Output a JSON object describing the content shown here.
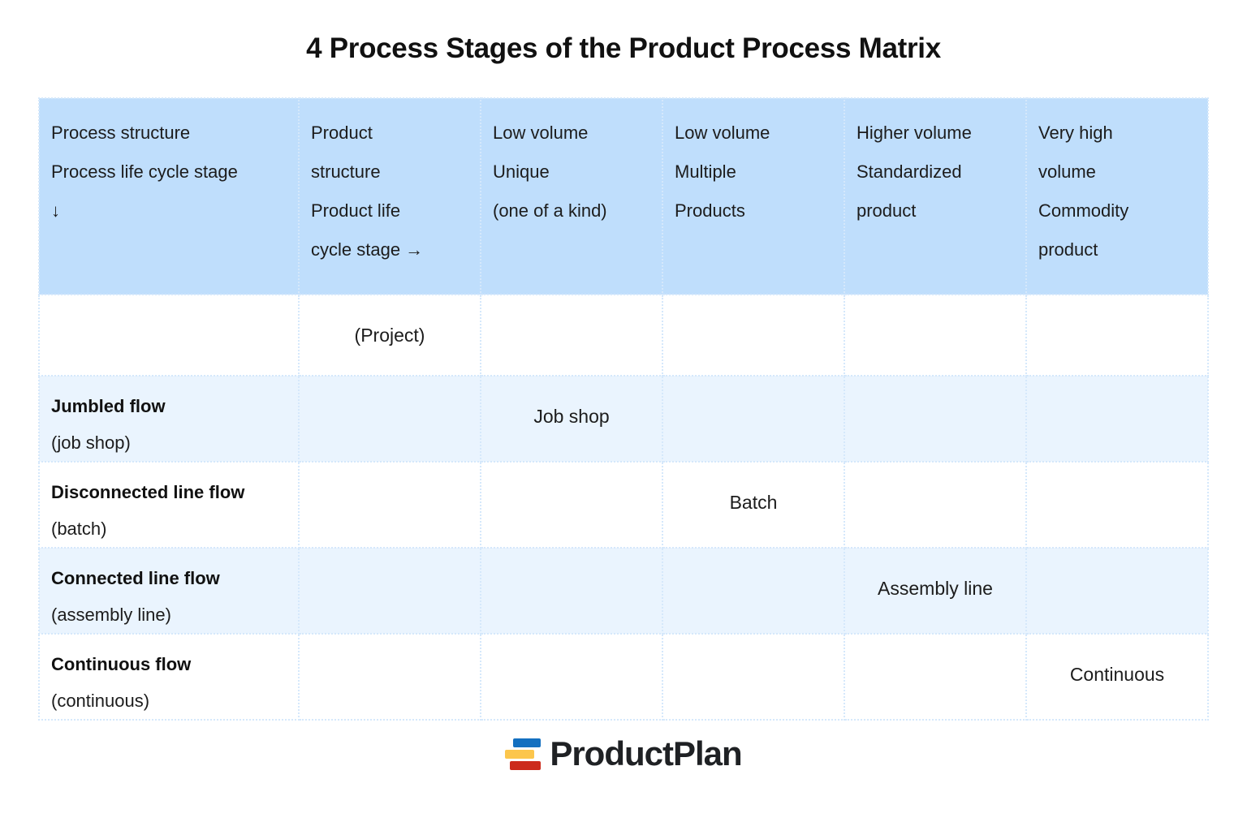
{
  "title": "4 Process Stages of the Product Process Matrix",
  "colors": {
    "header_bg": "#bfdefc",
    "row_tint_bg": "#eaf4fe",
    "row_white_bg": "#ffffff",
    "border": "#d5e8fb",
    "text": "#1c1c1c",
    "logo_blue": "#1470c0",
    "logo_yellow": "#fcc64c",
    "logo_red": "#cc2b1c",
    "logo_word": "#1f2124"
  },
  "matrix": {
    "header": [
      {
        "name": "process-structure",
        "lines": [
          "Process structure",
          "Process life cycle stage",
          "↓"
        ]
      },
      {
        "name": "product-structure",
        "lines": [
          "Product",
          "structure",
          "Product life",
          "cycle stage →"
        ]
      },
      {
        "name": "low-volume-unique",
        "lines": [
          "Low volume",
          "Unique",
          "(one of a kind)"
        ]
      },
      {
        "name": "low-volume-multiple",
        "lines": [
          "Low volume",
          "Multiple",
          "Products"
        ]
      },
      {
        "name": "higher-volume-standardized",
        "lines": [
          "Higher volume",
          "Standardized",
          "product"
        ]
      },
      {
        "name": "very-high-volume-commodity",
        "lines": [
          "Very high",
          "volume",
          "Commodity",
          "product"
        ]
      }
    ],
    "rows": [
      {
        "label_line1": "",
        "label_line2": "",
        "cells": [
          "(Project)",
          "",
          "",
          "",
          ""
        ],
        "tint": false
      },
      {
        "label_line1": "Jumbled flow",
        "label_line2": "(job shop)",
        "cells": [
          "",
          "Job shop",
          "",
          "",
          ""
        ],
        "tint": true
      },
      {
        "label_line1": "Disconnected line flow",
        "label_line2": "(batch)",
        "cells": [
          "",
          "",
          "Batch",
          "",
          ""
        ],
        "tint": false
      },
      {
        "label_line1": "Connected line flow",
        "label_line2": "(assembly line)",
        "cells": [
          "",
          "",
          "",
          "Assembly line",
          ""
        ],
        "tint": true
      },
      {
        "label_line1": "Continuous flow",
        "label_line2": "(continuous)",
        "cells": [
          "",
          "",
          "",
          "",
          "Continuous"
        ],
        "tint": false
      }
    ]
  },
  "footer": {
    "logo_text": "ProductPlan"
  }
}
